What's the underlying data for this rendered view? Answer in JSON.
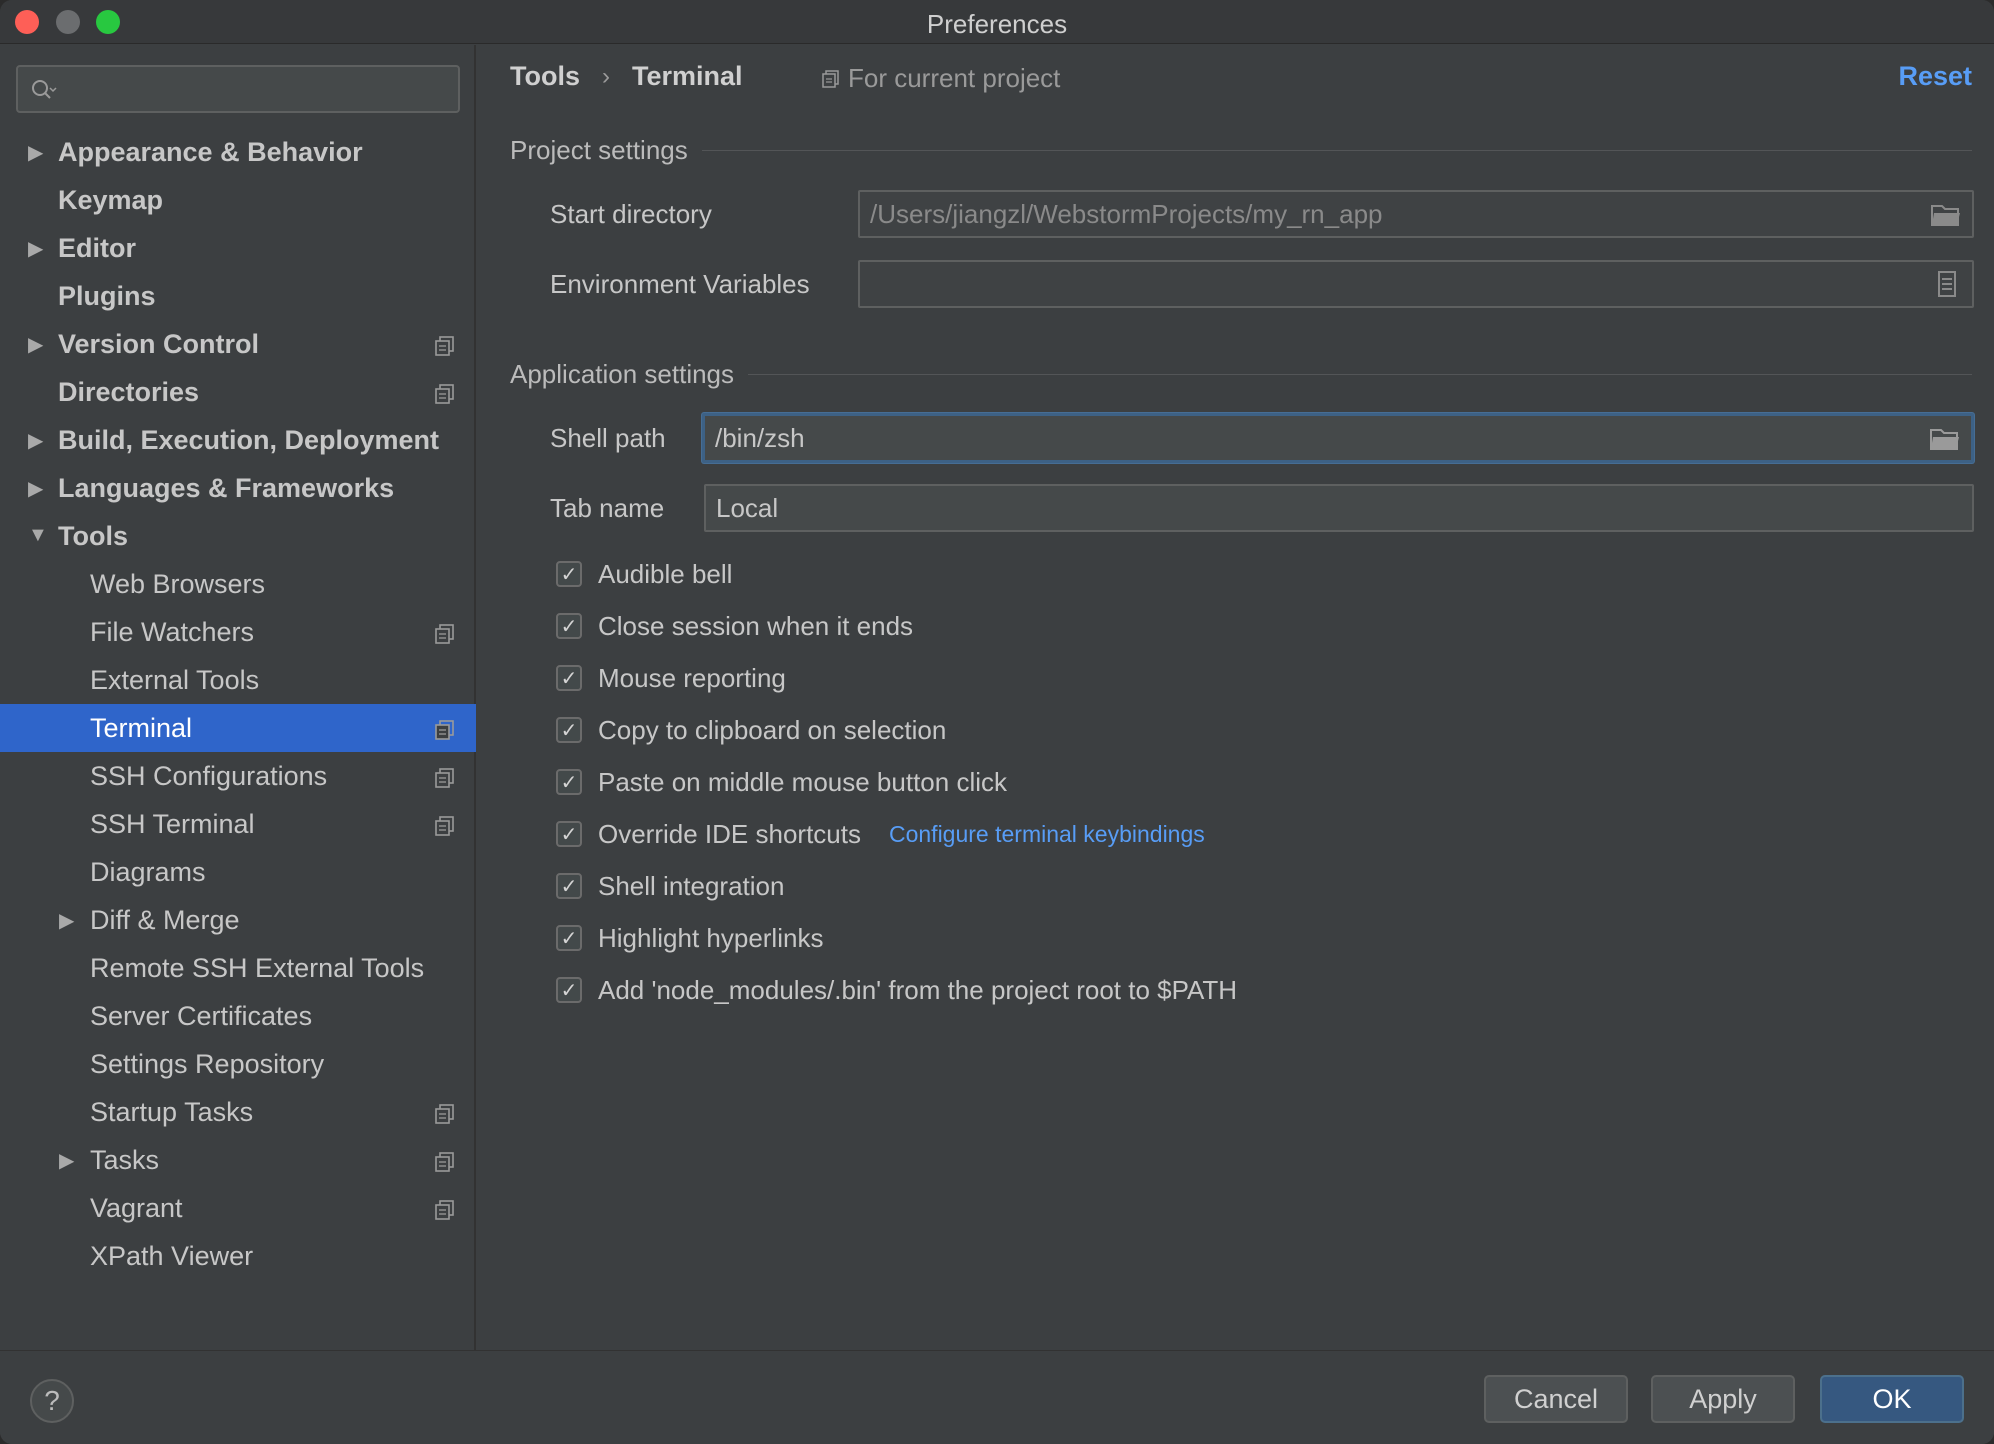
{
  "window": {
    "title": "Preferences"
  },
  "sidebar": {
    "search_placeholder": "",
    "items": [
      {
        "label": "Appearance & Behavior",
        "level": 0,
        "bold": true,
        "arrow": "right",
        "project": false
      },
      {
        "label": "Keymap",
        "level": 0,
        "bold": true,
        "arrow": "",
        "project": false
      },
      {
        "label": "Editor",
        "level": 0,
        "bold": true,
        "arrow": "right",
        "project": false
      },
      {
        "label": "Plugins",
        "level": 0,
        "bold": true,
        "arrow": "",
        "project": false
      },
      {
        "label": "Version Control",
        "level": 0,
        "bold": true,
        "arrow": "right",
        "project": true
      },
      {
        "label": "Directories",
        "level": 0,
        "bold": true,
        "arrow": "",
        "project": true
      },
      {
        "label": "Build, Execution, Deployment",
        "level": 0,
        "bold": true,
        "arrow": "right",
        "project": false
      },
      {
        "label": "Languages & Frameworks",
        "level": 0,
        "bold": true,
        "arrow": "right",
        "project": false
      },
      {
        "label": "Tools",
        "level": 0,
        "bold": true,
        "arrow": "down",
        "project": false
      },
      {
        "label": "Web Browsers",
        "level": 1,
        "bold": false,
        "arrow": "",
        "project": false
      },
      {
        "label": "File Watchers",
        "level": 1,
        "bold": false,
        "arrow": "",
        "project": true
      },
      {
        "label": "External Tools",
        "level": 1,
        "bold": false,
        "arrow": "",
        "project": false
      },
      {
        "label": "Terminal",
        "level": 1,
        "bold": false,
        "arrow": "",
        "project": true,
        "selected": true
      },
      {
        "label": "SSH Configurations",
        "level": 1,
        "bold": false,
        "arrow": "",
        "project": true
      },
      {
        "label": "SSH Terminal",
        "level": 1,
        "bold": false,
        "arrow": "",
        "project": true
      },
      {
        "label": "Diagrams",
        "level": 1,
        "bold": false,
        "arrow": "",
        "project": false
      },
      {
        "label": "Diff & Merge",
        "level": 1,
        "bold": false,
        "arrow": "right",
        "project": false
      },
      {
        "label": "Remote SSH External Tools",
        "level": 1,
        "bold": false,
        "arrow": "",
        "project": false
      },
      {
        "label": "Server Certificates",
        "level": 1,
        "bold": false,
        "arrow": "",
        "project": false
      },
      {
        "label": "Settings Repository",
        "level": 1,
        "bold": false,
        "arrow": "",
        "project": false
      },
      {
        "label": "Startup Tasks",
        "level": 1,
        "bold": false,
        "arrow": "",
        "project": true
      },
      {
        "label": "Tasks",
        "level": 1,
        "bold": false,
        "arrow": "right",
        "project": true
      },
      {
        "label": "Vagrant",
        "level": 1,
        "bold": false,
        "arrow": "",
        "project": true
      },
      {
        "label": "XPath Viewer",
        "level": 1,
        "bold": false,
        "arrow": "",
        "project": false
      }
    ]
  },
  "main": {
    "breadcrumb": {
      "parent": "Tools",
      "separator": "›",
      "current": "Terminal"
    },
    "scope_label": "For current project",
    "reset_label": "Reset",
    "project_settings": {
      "title": "Project settings",
      "start_directory_label": "Start directory",
      "start_directory_value": "/Users/jiangzl/WebstormProjects/my_rn_app",
      "env_vars_label": "Environment Variables",
      "env_vars_value": ""
    },
    "application_settings": {
      "title": "Application settings",
      "shell_path_label": "Shell path",
      "shell_path_value": "/bin/zsh",
      "tab_name_label": "Tab name",
      "tab_name_value": "Local"
    },
    "checkboxes": [
      {
        "label": "Audible bell",
        "checked": true
      },
      {
        "label": "Close session when it ends",
        "checked": true
      },
      {
        "label": "Mouse reporting",
        "checked": true
      },
      {
        "label": "Copy to clipboard on selection",
        "checked": true
      },
      {
        "label": "Paste on middle mouse button click",
        "checked": true
      },
      {
        "label": "Override IDE shortcuts",
        "checked": true,
        "link": "Configure terminal keybindings"
      },
      {
        "label": "Shell integration",
        "checked": true
      },
      {
        "label": "Highlight hyperlinks",
        "checked": true
      },
      {
        "label": "Add 'node_modules/.bin' from the project root to $PATH",
        "checked": true
      }
    ]
  },
  "footer": {
    "help_label": "?",
    "cancel_label": "Cancel",
    "apply_label": "Apply",
    "ok_label": "OK"
  },
  "colors": {
    "accent": "#589df6",
    "selection": "#2f65ca",
    "ok_button": "#365880"
  }
}
